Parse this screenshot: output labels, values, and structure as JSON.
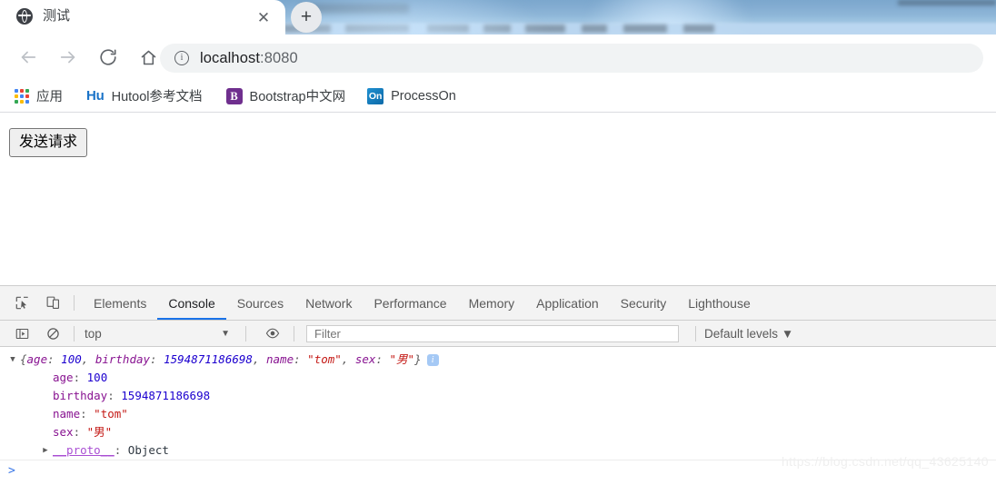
{
  "browser": {
    "tab": {
      "title": "测试",
      "favicon": "globe-icon",
      "close_label": "✕"
    },
    "new_tab_label": "+",
    "nav": {
      "back": "back-arrow",
      "forward": "forward-arrow",
      "reload": "reload",
      "home": "home"
    },
    "omnibox": {
      "url_host": "localhost",
      "url_port": ":8080",
      "info_icon": "site-info-icon"
    },
    "bookmarks": [
      {
        "label": "应用",
        "icon": "apps-grid-icon"
      },
      {
        "label": "Hutool参考文档",
        "icon": "hutool-icon",
        "icon_text": "Hu"
      },
      {
        "label": "Bootstrap中文网",
        "icon": "bootstrap-icon",
        "icon_text": "B"
      },
      {
        "label": "ProcessOn",
        "icon": "processon-icon",
        "icon_text": "On"
      }
    ]
  },
  "page": {
    "send_button": "发送请求"
  },
  "devtools": {
    "inspect_icon": "inspect-element-icon",
    "device_icon": "device-toolbar-icon",
    "tabs": [
      {
        "label": "Elements",
        "active": false
      },
      {
        "label": "Console",
        "active": true
      },
      {
        "label": "Sources",
        "active": false
      },
      {
        "label": "Network",
        "active": false
      },
      {
        "label": "Performance",
        "active": false
      },
      {
        "label": "Memory",
        "active": false
      },
      {
        "label": "Application",
        "active": false
      },
      {
        "label": "Security",
        "active": false
      },
      {
        "label": "Lighthouse",
        "active": false
      }
    ],
    "console_toolbar": {
      "sidebar_icon": "console-sidebar-icon",
      "clear_icon": "clear-console-icon",
      "context": "top",
      "context_caret": "▼",
      "eye_icon": "live-expression-icon",
      "filter_placeholder": "Filter",
      "filter_value": "",
      "levels": "Default levels",
      "levels_caret": "▼"
    },
    "console_output": {
      "summary": {
        "twisty": "▼",
        "open_brace": "{",
        "close_brace": "}",
        "parts": [
          {
            "key": "age",
            "value": "100",
            "type": "number"
          },
          {
            "key": "birthday",
            "value": "1594871186698",
            "type": "number"
          },
          {
            "key": "name",
            "value": "\"tom\"",
            "type": "string"
          },
          {
            "key": "sex",
            "value": "\"男\"",
            "type": "string"
          }
        ],
        "info_badge": "i"
      },
      "properties": [
        {
          "key": "age",
          "value": "100",
          "type": "number"
        },
        {
          "key": "birthday",
          "value": "1594871186698",
          "type": "number"
        },
        {
          "key": "name",
          "value": "\"tom\"",
          "type": "string"
        },
        {
          "key": "sex",
          "value": "\"男\"",
          "type": "string"
        }
      ],
      "proto": {
        "twisty": "▶",
        "key": "__proto__",
        "value": "Object"
      },
      "prompt": ">"
    }
  },
  "watermark": "https://blog.csdn.net/qq_43625140",
  "colors": {
    "accent": "#1a73e8",
    "property": "#881391",
    "number": "#1c00cf",
    "string": "#c41a16",
    "proto": "#a94fd3"
  }
}
